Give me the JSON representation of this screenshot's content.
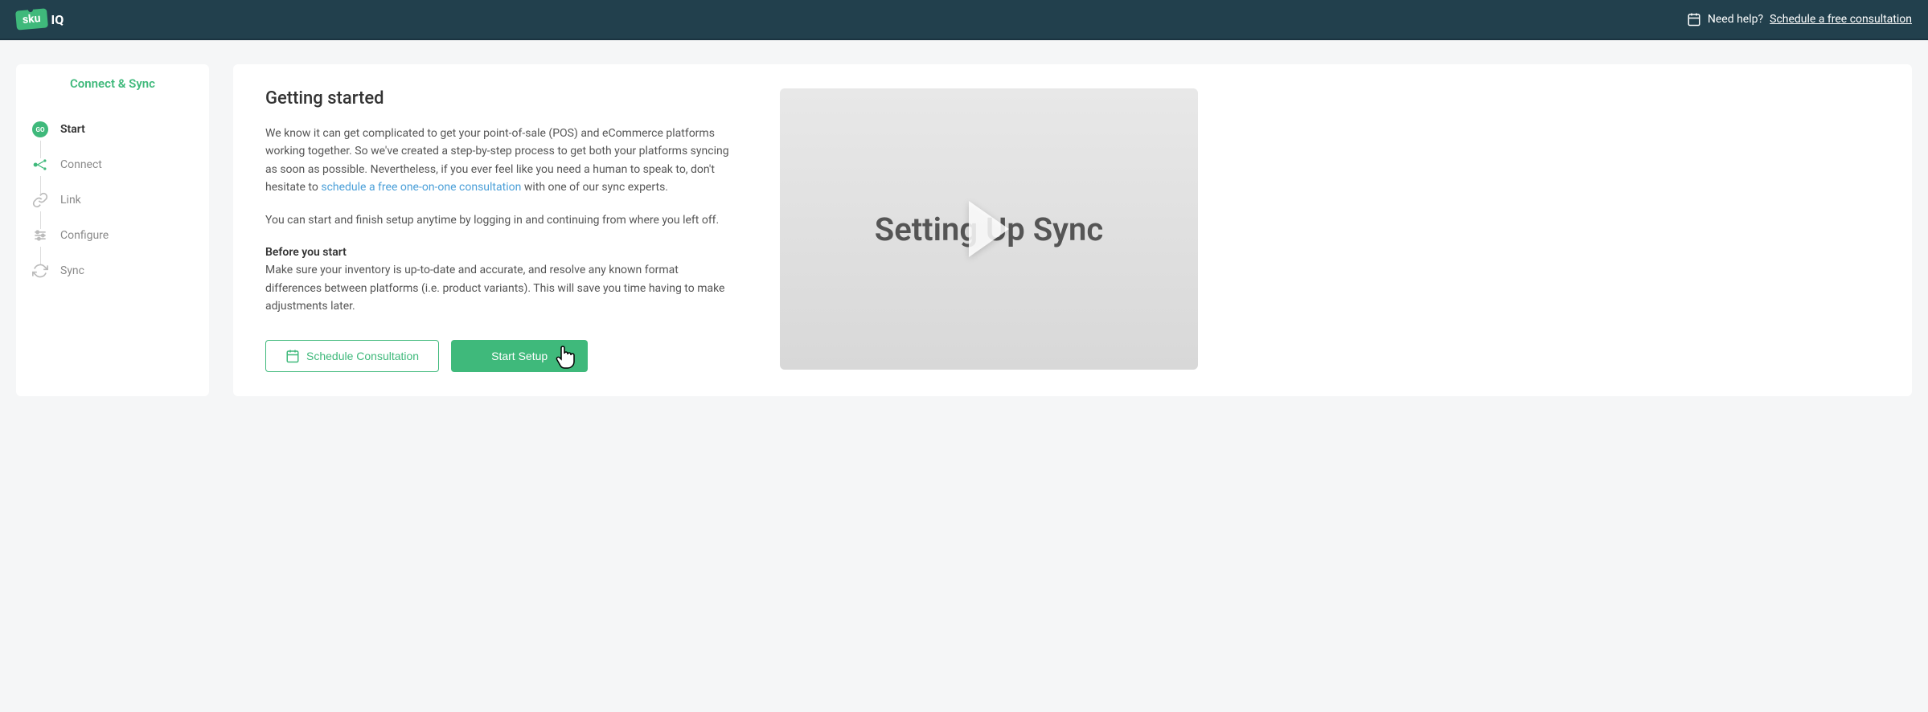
{
  "header": {
    "logo_text": "sku",
    "logo_suffix": "IQ",
    "help_prefix": "Need help?",
    "help_link": "Schedule a free consultation"
  },
  "sidebar": {
    "title": "Connect & Sync",
    "steps": [
      {
        "label": "Start",
        "active": true
      },
      {
        "label": "Connect",
        "active": false
      },
      {
        "label": "Link",
        "active": false
      },
      {
        "label": "Configure",
        "active": false
      },
      {
        "label": "Sync",
        "active": false
      }
    ]
  },
  "main": {
    "title": "Getting started",
    "para1_a": "We know it can get complicated to get your point-of-sale (POS) and eCommerce platforms working together. So we've created a step-by-step process to get both your platforms syncing as soon as possible. Nevertheless, if you ever feel like you need a human to speak to, don't hesitate to ",
    "para1_link": "schedule a free one-on-one consultation",
    "para1_b": " with one of our sync experts.",
    "para2": "You can start and finish setup anytime by logging in and continuing from where you left off.",
    "before_heading": "Before you start",
    "before_text": "Make sure your inventory is up-to-date and accurate, and resolve any known format differences between platforms (i.e. product variants). This will save you time having to make adjustments later.",
    "schedule_button": "Schedule Consultation",
    "start_button": "Start Setup"
  },
  "video": {
    "title": "Setting Up Sync"
  }
}
